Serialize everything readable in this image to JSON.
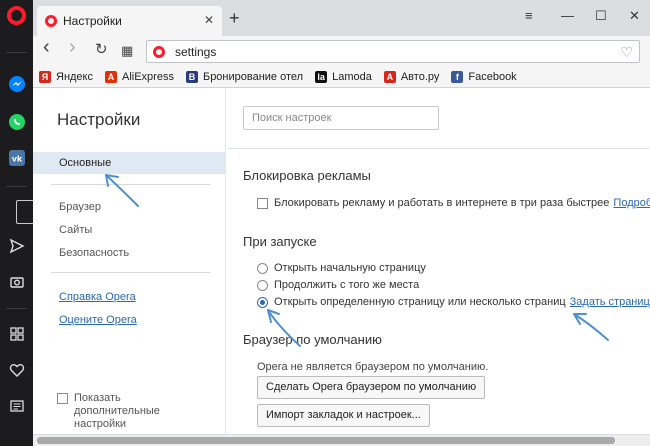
{
  "tab": {
    "title": "Настройки",
    "close": "✕",
    "new_tab": "+"
  },
  "window": {
    "menu": "≡",
    "minimize": "—",
    "maximize": "☐",
    "close": "✕"
  },
  "toolbar": {
    "back": "‹",
    "forward": "›",
    "reload": "↻",
    "speed_dial": "▦",
    "url": "settings"
  },
  "bookmarks": [
    {
      "label": "Яндекс",
      "icon": "yandex-icon",
      "glyph": "Я",
      "color": "#d7261b"
    },
    {
      "label": "AliExpress",
      "icon": "aliexpress-icon",
      "glyph": "A",
      "color": "#e62e04"
    },
    {
      "label": "Бронирование отел",
      "icon": "booking-icon",
      "glyph": "B",
      "color": "#273b7d"
    },
    {
      "label": "Lamoda",
      "icon": "lamoda-icon",
      "glyph": "la",
      "color": "#111111"
    },
    {
      "label": "Авто.ру",
      "icon": "autoru-icon",
      "glyph": "A",
      "color": "#d7261b"
    },
    {
      "label": "Facebook",
      "icon": "facebook-icon",
      "glyph": "f",
      "color": "#3b5998"
    }
  ],
  "settings_nav": {
    "title": "Настройки",
    "items": [
      "Основные",
      "Браузер",
      "Сайты",
      "Безопасность"
    ],
    "active_index": 0,
    "help_link": "Справка Opera",
    "rate_link": "Оцените Opera",
    "advanced_label": "Показать дополнительные настройки"
  },
  "main": {
    "search_placeholder": "Поиск настроек",
    "adblock": {
      "heading": "Блокировка рекламы",
      "checkbox_label": "Блокировать рекламу и работать в интернете в три раза быстрее",
      "more_link": "Подробнее..."
    },
    "startup": {
      "heading": "При запуске",
      "options": [
        "Открыть начальную страницу",
        "Продолжить с того же места",
        "Открыть определенную страницу или несколько страниц"
      ],
      "selected_index": 2,
      "set_pages_link": "Задать страницы"
    },
    "default_browser": {
      "heading": "Браузер по умолчанию",
      "note": "Opera не является браузером по умолчанию.",
      "make_default_button": "Сделать Opera браузером по умолчанию",
      "import_button": "Импорт закладок и настроек..."
    }
  },
  "colors": {
    "accent": "#2a68b1",
    "opera_red": "#ff1b2d",
    "sidebar": "#1c1c1f",
    "active_nav": "#dfe9f3"
  }
}
